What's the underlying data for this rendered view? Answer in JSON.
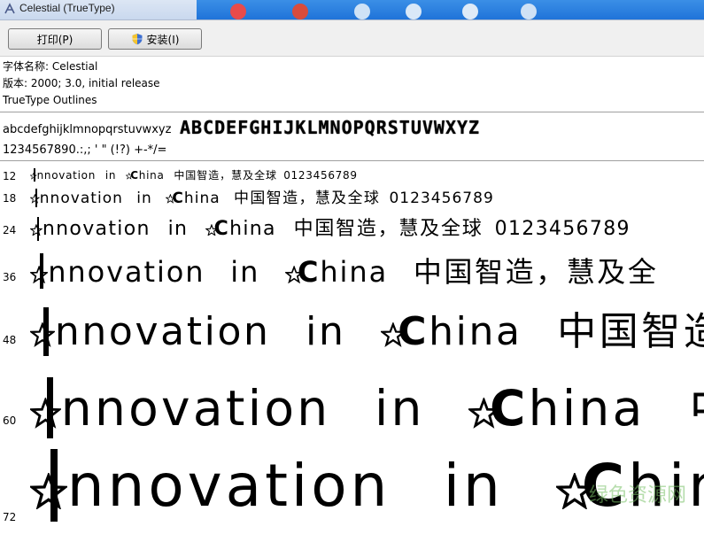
{
  "window": {
    "title": "Celestial (TrueType)"
  },
  "toolbar": {
    "print_label": "打印(P)",
    "install_label": "安装(I)"
  },
  "info": {
    "font_name": "字体名称: Celestial",
    "version": "版本: 2000; 3.0, initial release",
    "type": "TrueType Outlines"
  },
  "charset": {
    "lowercase": "abcdefghijklmnopqrstuvwxyz",
    "uppercase": "ABCDEFGHIJKLMNOPQRSTUVWXYZ",
    "digits": "1234567890.:,;  '  \"  (!?)  +-*/="
  },
  "samples": [
    {
      "size": "12",
      "latin1": "nnovation",
      "latin2": "in",
      "latin3": "hina",
      "cjk": "中国智造，慧及全球",
      "digits": "0123456789"
    },
    {
      "size": "18",
      "latin1": "nnovation",
      "latin2": "in",
      "latin3": "hina",
      "cjk": "中国智造，慧及全球",
      "digits": "0123456789"
    },
    {
      "size": "24",
      "latin1": "nnovation",
      "latin2": "in",
      "latin3": "hina",
      "cjk": "中国智造，慧及全球",
      "digits": "0123456789"
    },
    {
      "size": "36",
      "latin1": "nnovation",
      "latin2": "in",
      "latin3": "hina",
      "cjk": "中国智造，慧及全",
      "digits": ""
    },
    {
      "size": "48",
      "latin1": "nnovation",
      "latin2": "in",
      "latin3": "hina",
      "cjk": "中国智造",
      "digits": ""
    },
    {
      "size": "60",
      "latin1": "nnovation",
      "latin2": "in",
      "latin3": "hina",
      "cjk": "中国",
      "digits": ""
    },
    {
      "size": "72",
      "latin1": "nnovation",
      "latin2": "in",
      "latin3": "hina",
      "cjk": "",
      "digits": ""
    }
  ]
}
